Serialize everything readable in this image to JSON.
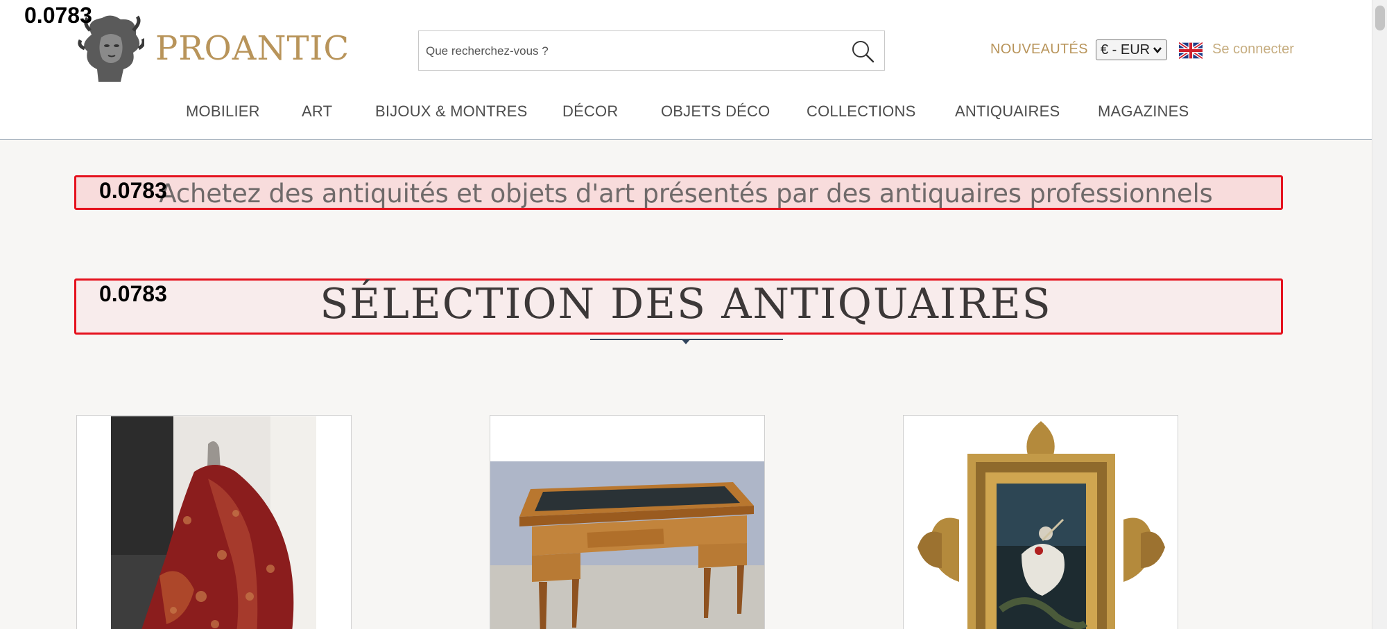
{
  "header": {
    "logo_text": "PROANTIC",
    "search_placeholder": "Que recherchez-vous ?",
    "nouveautes_label": "NOUVEAUTÉS",
    "currency_value": "€ - EUR",
    "login_label": "Se connecter",
    "icons": {
      "logo": "bust-logo-icon",
      "search": "search-icon",
      "flag": "uk-flag-icon",
      "select": "chevron-down-icon"
    }
  },
  "nav": {
    "items": [
      "MOBILIER",
      "ART",
      "BIJOUX & MONTRES",
      "DÉCOR",
      "OBJETS DÉCO",
      "COLLECTIONS",
      "ANTIQUAIRES",
      "MAGAZINES"
    ]
  },
  "overlay": {
    "scores": [
      "0.0783",
      "0.0783",
      "0.0783"
    ]
  },
  "main": {
    "tagline": "Achetez des antiquités et objets d'art présentés par des antiquaires professionnels",
    "section_title": "SÉLECTION DES ANTIQUAIRES",
    "products": [
      {
        "name": "paisley-fabric-image"
      },
      {
        "name": "writing-desk-image"
      },
      {
        "name": "gilt-frame-painting-image"
      }
    ]
  },
  "colors": {
    "brand_gold": "#b8945a",
    "highlight_red": "#e5121e",
    "nav_text": "#4d4d4d",
    "background": "#f7f6f4"
  }
}
